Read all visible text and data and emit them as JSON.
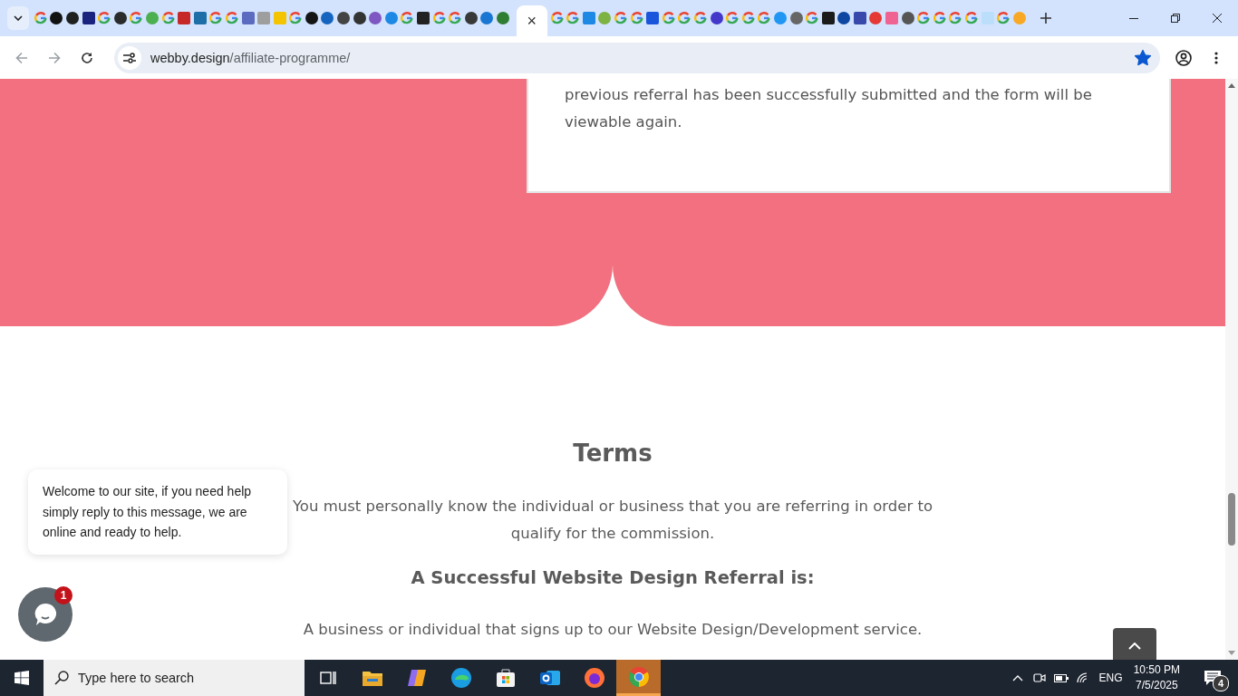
{
  "browser": {
    "tabs": [
      {
        "kind": "google",
        "selected": false
      },
      {
        "kind": "circle",
        "color": "#111111",
        "selected": false
      },
      {
        "kind": "circle",
        "color": "#1f1f1f",
        "selected": false
      },
      {
        "kind": "square",
        "color": "#1a237e",
        "selected": false
      },
      {
        "kind": "google",
        "selected": false
      },
      {
        "kind": "circle",
        "color": "#2b2b2b",
        "selected": false
      },
      {
        "kind": "google",
        "selected": false
      },
      {
        "kind": "circle",
        "color": "#4caf50",
        "selected": false
      },
      {
        "kind": "google",
        "selected": false
      },
      {
        "kind": "square",
        "color": "#c62828",
        "selected": false
      },
      {
        "kind": "square",
        "color": "#1e6ea7",
        "selected": false
      },
      {
        "kind": "google",
        "selected": false
      },
      {
        "kind": "google",
        "selected": false
      },
      {
        "kind": "square",
        "color": "#5c6bc0",
        "selected": false
      },
      {
        "kind": "square",
        "color": "#9e9e9e",
        "selected": false
      },
      {
        "kind": "square",
        "color": "#f5c400",
        "selected": false
      },
      {
        "kind": "google",
        "selected": false
      },
      {
        "kind": "circle",
        "color": "#151515",
        "selected": false
      },
      {
        "kind": "circle",
        "color": "#1565c0",
        "selected": false
      },
      {
        "kind": "circle",
        "color": "#444444",
        "selected": false
      },
      {
        "kind": "circle",
        "color": "#333333",
        "selected": false
      },
      {
        "kind": "circle",
        "color": "#7e57c2",
        "selected": false
      },
      {
        "kind": "circle",
        "color": "#1e88e5",
        "selected": false
      },
      {
        "kind": "google",
        "selected": false
      },
      {
        "kind": "square",
        "color": "#222222",
        "selected": false
      },
      {
        "kind": "google",
        "selected": false
      },
      {
        "kind": "google",
        "selected": false
      },
      {
        "kind": "circle",
        "color": "#383838",
        "selected": false
      },
      {
        "kind": "circle",
        "color": "#1976d2",
        "selected": false
      },
      {
        "kind": "circle",
        "color": "#2e7d32",
        "selected": false
      },
      {
        "kind": "none",
        "selected": true,
        "close": "×"
      },
      {
        "kind": "google",
        "selected": false
      },
      {
        "kind": "google",
        "selected": false
      },
      {
        "kind": "square",
        "color": "#1e88e5",
        "selected": false
      },
      {
        "kind": "circle",
        "color": "#7cb342",
        "selected": false
      },
      {
        "kind": "google",
        "selected": false
      },
      {
        "kind": "google",
        "selected": false
      },
      {
        "kind": "square",
        "color": "#1a56db",
        "selected": false
      },
      {
        "kind": "google",
        "selected": false
      },
      {
        "kind": "google",
        "selected": false
      },
      {
        "kind": "google",
        "selected": false
      },
      {
        "kind": "circle",
        "color": "#4338ca",
        "selected": false
      },
      {
        "kind": "google",
        "selected": false
      },
      {
        "kind": "google",
        "selected": false
      },
      {
        "kind": "google",
        "selected": false
      },
      {
        "kind": "circle",
        "color": "#2196f3",
        "selected": false
      },
      {
        "kind": "circle",
        "color": "#666666",
        "selected": false
      },
      {
        "kind": "google",
        "selected": false
      },
      {
        "kind": "square",
        "color": "#1b1b1b",
        "selected": false
      },
      {
        "kind": "circle",
        "color": "#0d47a1",
        "selected": false
      },
      {
        "kind": "square",
        "color": "#3949ab",
        "selected": false
      },
      {
        "kind": "circle",
        "color": "#e53935",
        "selected": false
      },
      {
        "kind": "square",
        "color": "#f06292",
        "selected": false
      },
      {
        "kind": "circle",
        "color": "#555555",
        "selected": false
      },
      {
        "kind": "google",
        "selected": false
      },
      {
        "kind": "google",
        "selected": false
      },
      {
        "kind": "google",
        "selected": false
      },
      {
        "kind": "google",
        "selected": false
      },
      {
        "kind": "square",
        "color": "#bbdefb",
        "selected": false
      },
      {
        "kind": "google",
        "selected": false
      },
      {
        "kind": "circle",
        "color": "#f9a825",
        "selected": false
      }
    ],
    "address": {
      "host": "webby.design",
      "path": "/affiliate-programme/",
      "bookmarked": true
    }
  },
  "page": {
    "card_text": "previous referral has been successfully submitted and the form will be viewable again.",
    "terms": {
      "title": "Terms",
      "intro": "You must personally know the individual or business that you are referring in order to qualify for the commission.",
      "subtitle": "A Successful Website Design Referral is:",
      "item": "A business or individual that signs up to our Website Design/Development service."
    },
    "chat": {
      "message": "Welcome to our site, if you need help simply reply to this message, we are online and ready to help.",
      "badge": "1"
    }
  },
  "taskbar": {
    "search_placeholder": "Type here to search",
    "apps": [
      {
        "kind": "task-view",
        "selected": false
      },
      {
        "kind": "folder",
        "selected": false
      },
      {
        "kind": "copilot",
        "selected": false
      },
      {
        "kind": "edge",
        "selected": false
      },
      {
        "kind": "store",
        "selected": false
      },
      {
        "kind": "outlook",
        "selected": false
      },
      {
        "kind": "firefox",
        "selected": false
      },
      {
        "kind": "chrome",
        "selected": true
      }
    ],
    "language": "ENG",
    "time": "10:50 PM",
    "date": "7/5/2025",
    "notifications": "4"
  }
}
